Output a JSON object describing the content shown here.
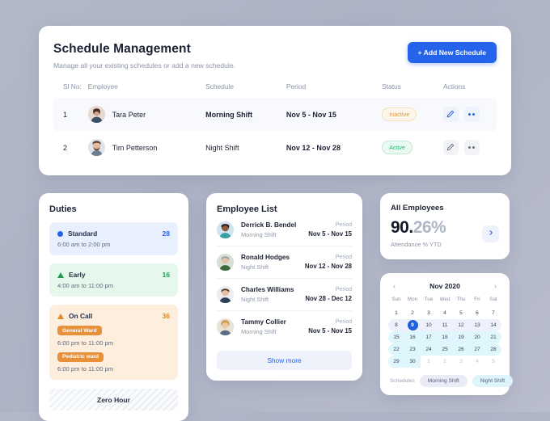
{
  "header": {
    "title": "Schedule Management",
    "subtitle": "Manage all your existing schedules or add a new schedule.",
    "add_button": "+ Add New Schedule"
  },
  "schedule_table": {
    "columns": [
      "Sl No:",
      "Employee",
      "Schedule",
      "Period",
      "Status",
      "Actions"
    ],
    "rows": [
      {
        "sl": "1",
        "employee": "Tara Peter",
        "schedule": "Morning Shift",
        "period": "Nov 5 - Nov 15",
        "status": "Inactive"
      },
      {
        "sl": "2",
        "employee": "Tim Petterson",
        "schedule": "Night Shift",
        "period": "Nov 12 - Nov 28",
        "status": "Active"
      }
    ]
  },
  "duties": {
    "title": "Duties",
    "items": [
      {
        "name": "Standard",
        "time": "6:00 am to 2:00 pm",
        "count": "28"
      },
      {
        "name": "Early",
        "time": "4:00 am to 11:00 pm",
        "count": "16"
      },
      {
        "name": "On Call",
        "count": "36",
        "wards": [
          {
            "label": "General Ward",
            "time": "6:00 pm to 11:00 pm"
          },
          {
            "label": "Pediatric ward",
            "time": "6:00 pm to 11:00 pm"
          }
        ]
      }
    ],
    "zero_hour": "Zero Hour"
  },
  "employee_list": {
    "title": "Employee List",
    "period_label": "Period",
    "show_more": "Show more",
    "items": [
      {
        "name": "Derrick B. Bendel",
        "shift": "Morning Shift",
        "period": "Nov 5 - Nov 15"
      },
      {
        "name": "Ronald Hodges",
        "shift": "Night Shift",
        "period": "Nov 12 - Nov 28"
      },
      {
        "name": "Charles Williams",
        "shift": "Night Shift",
        "period": "Nov 28 - Dec 12"
      },
      {
        "name": "Tammy Collier",
        "shift": "Morning Shift",
        "period": "Nov 5 - Nov 15"
      }
    ]
  },
  "all_employees": {
    "title": "All Employees",
    "value_major": "90.",
    "value_minor": "26%",
    "caption": "Attendance % YTD"
  },
  "calendar": {
    "month": "Nov 2020",
    "prev": "‹",
    "next": "›",
    "dow": [
      "Sun",
      "Mon",
      "Tue",
      "Wed",
      "Thu",
      "Fri",
      "Sat"
    ],
    "weeks": [
      {
        "highlight": "none",
        "days": [
          {
            "d": "1",
            "mute": false
          },
          {
            "d": "2",
            "mute": false
          },
          {
            "d": "3",
            "mute": false
          },
          {
            "d": "4",
            "mute": false
          },
          {
            "d": "5",
            "mute": false
          },
          {
            "d": "6",
            "mute": false
          },
          {
            "d": "7",
            "mute": false
          }
        ]
      },
      {
        "highlight": "lav",
        "days": [
          {
            "d": "8",
            "mute": false
          },
          {
            "d": "9",
            "mute": false,
            "selected": true
          },
          {
            "d": "10",
            "mute": false
          },
          {
            "d": "11",
            "mute": false
          },
          {
            "d": "12",
            "mute": false
          },
          {
            "d": "13",
            "mute": false
          },
          {
            "d": "14",
            "mute": false
          }
        ]
      },
      {
        "highlight": "cyan",
        "days": [
          {
            "d": "15",
            "mute": false
          },
          {
            "d": "16",
            "mute": false
          },
          {
            "d": "17",
            "mute": false
          },
          {
            "d": "18",
            "mute": false
          },
          {
            "d": "19",
            "mute": false
          },
          {
            "d": "20",
            "mute": false
          },
          {
            "d": "21",
            "mute": false
          }
        ]
      },
      {
        "highlight": "cyan",
        "days": [
          {
            "d": "22",
            "mute": false
          },
          {
            "d": "23",
            "mute": false
          },
          {
            "d": "24",
            "mute": false
          },
          {
            "d": "25",
            "mute": false
          },
          {
            "d": "26",
            "mute": false
          },
          {
            "d": "27",
            "mute": false
          },
          {
            "d": "28",
            "mute": false
          }
        ]
      },
      {
        "highlight": "cyan-part",
        "days": [
          {
            "d": "29",
            "mute": false
          },
          {
            "d": "30",
            "mute": false
          },
          {
            "d": "1",
            "mute": true
          },
          {
            "d": "2",
            "mute": true
          },
          {
            "d": "3",
            "mute": true
          },
          {
            "d": "4",
            "mute": true
          },
          {
            "d": "5",
            "mute": true
          }
        ]
      }
    ],
    "legend_label": "Schedules",
    "legend": [
      "Morning Shift",
      "Night Shift"
    ]
  },
  "colors": {
    "accent": "#2563eb",
    "active": "#2bb673",
    "inactive": "#e09a3e",
    "ward": "#e8913a",
    "cal_selected": "#1f5fe0"
  }
}
